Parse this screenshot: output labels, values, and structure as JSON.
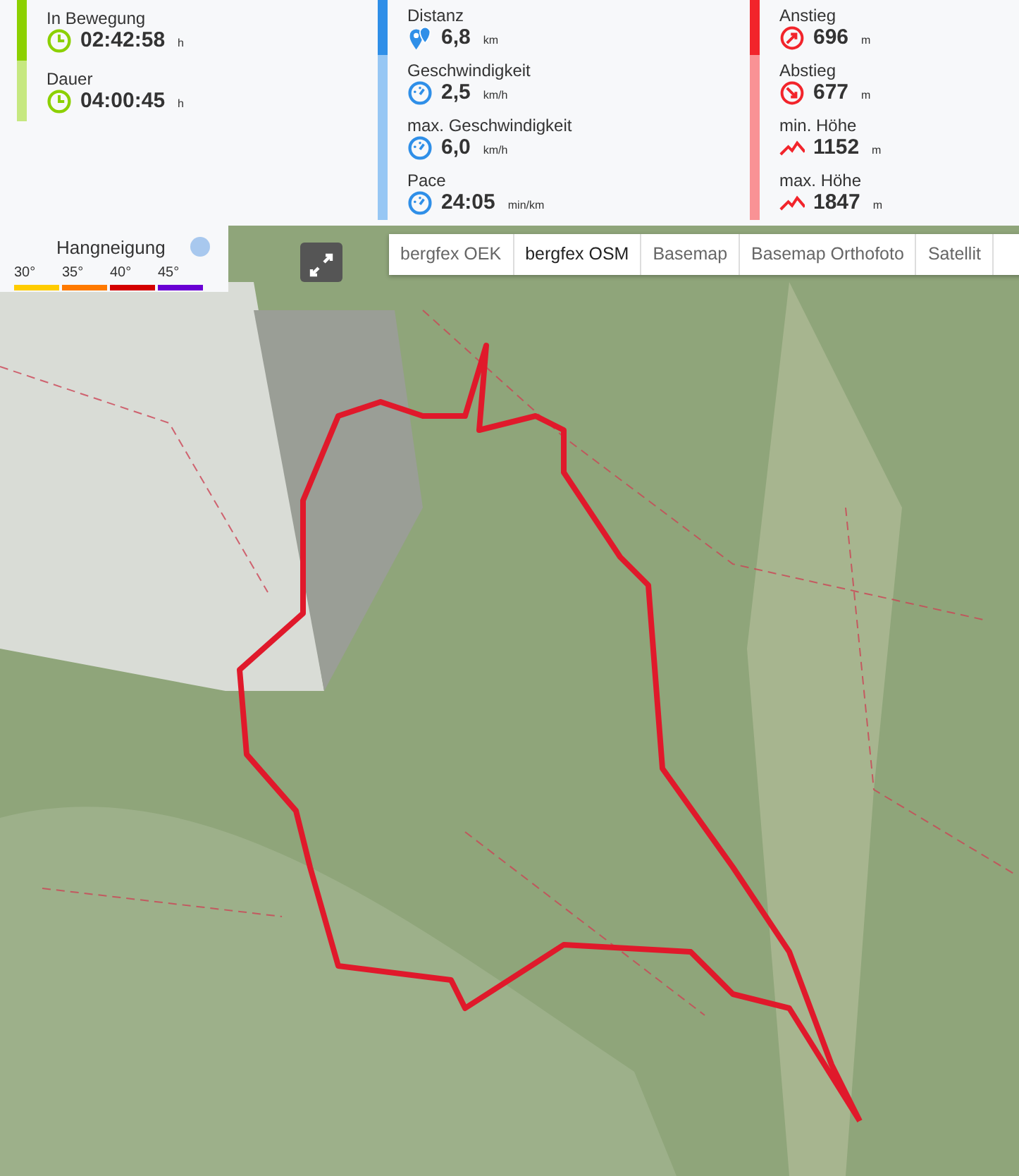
{
  "stats": [
    {
      "color": "#8cd000",
      "items": [
        {
          "label": "In Bewegung",
          "kind": "clock",
          "value": "02:42:58",
          "unit": "h",
          "primary": true
        },
        {
          "label": "Dauer",
          "kind": "clock",
          "value": "04:00:45",
          "unit": "h",
          "primary": false
        }
      ]
    },
    {
      "color": "#2f8fe8",
      "items": [
        {
          "label": "Distanz",
          "kind": "pins",
          "value": "6,8",
          "unit": "km",
          "primary": true
        },
        {
          "label": "Geschwindigkeit",
          "kind": "gauge",
          "value": "2,5",
          "unit": "km/h",
          "primary": false
        },
        {
          "label": "max. Geschwindigkeit",
          "kind": "gauge",
          "value": "6,0",
          "unit": "km/h",
          "primary": false
        },
        {
          "label": "Pace",
          "kind": "gauge",
          "value": "24:05",
          "unit": "min/km",
          "primary": false
        }
      ]
    },
    {
      "color": "#f2242b",
      "items": [
        {
          "label": "Anstieg",
          "kind": "ascent",
          "value": "696",
          "unit": "m",
          "primary": true
        },
        {
          "label": "Abstieg",
          "kind": "descent",
          "value": "677",
          "unit": "m",
          "primary": false
        },
        {
          "label": "min. Höhe",
          "kind": "peak",
          "value": "1152",
          "unit": "m",
          "primary": false
        },
        {
          "label": "max. Höhe",
          "kind": "peak",
          "value": "1847",
          "unit": "m",
          "primary": false
        }
      ]
    }
  ],
  "legend": {
    "title": "Hangneigung",
    "scale": [
      {
        "label": "30°",
        "color": "#ffcc00"
      },
      {
        "label": "35°",
        "color": "#ff7a00"
      },
      {
        "label": "40°",
        "color": "#d40000"
      },
      {
        "label": "45°",
        "color": "#6a00d4"
      }
    ]
  },
  "layers": [
    {
      "label": "bergfex OEK",
      "selected": false
    },
    {
      "label": "bergfex OSM",
      "selected": true
    },
    {
      "label": "Basemap",
      "selected": false
    },
    {
      "label": "Basemap Orthofoto",
      "selected": false
    },
    {
      "label": "Satellit",
      "selected": false
    }
  ]
}
